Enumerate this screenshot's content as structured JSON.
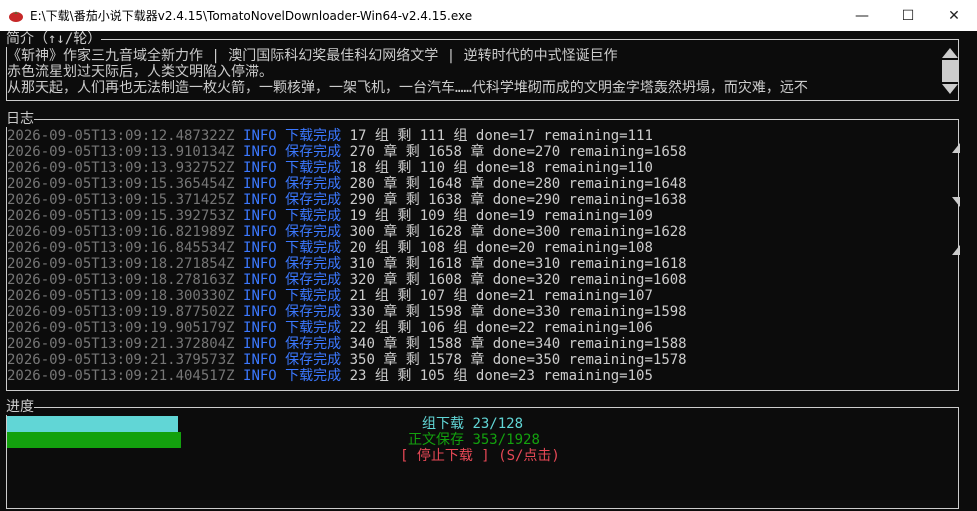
{
  "window": {
    "title": "E:\\下载\\番茄小说下载器v2.4.15\\TomatoNovelDownloader-Win64-v2.4.15.exe",
    "minimize_glyph": "—",
    "maximize_glyph": "☐",
    "close_glyph": "✕"
  },
  "intro": {
    "label": "简介（↑↓/轮）",
    "lines": [
      "《斩神》作家三九音域全新力作 | 澳门国际科幻奖最佳科幻网络文学 | 逆转时代的中式怪诞巨作",
      "赤色流星划过天际后，人类文明陷入停滞。",
      "从那天起，人们再也无法制造一枚火箭，一颗核弹，一架飞机，一台汽车……代科学堆砌而成的文明金字塔轰然坍塌，而灾难，远不"
    ]
  },
  "log": {
    "label": "日志",
    "rows": [
      {
        "ts": "2026-09-05T13:09:12.487322Z",
        "level": "INFO",
        "event": "下载完成",
        "msg": "17 组 剩 111 组 done=17 remaining=111"
      },
      {
        "ts": "2026-09-05T13:09:13.910134Z",
        "level": "INFO",
        "event": "保存完成",
        "msg": "270 章 剩 1658 章 done=270 remaining=1658"
      },
      {
        "ts": "2026-09-05T13:09:13.932752Z",
        "level": "INFO",
        "event": "下载完成",
        "msg": "18 组 剩 110 组 done=18 remaining=110"
      },
      {
        "ts": "2026-09-05T13:09:15.365454Z",
        "level": "INFO",
        "event": "保存完成",
        "msg": "280 章 剩 1648 章 done=280 remaining=1648"
      },
      {
        "ts": "2026-09-05T13:09:15.371425Z",
        "level": "INFO",
        "event": "保存完成",
        "msg": "290 章 剩 1638 章 done=290 remaining=1638"
      },
      {
        "ts": "2026-09-05T13:09:15.392753Z",
        "level": "INFO",
        "event": "下载完成",
        "msg": "19 组 剩 109 组 done=19 remaining=109"
      },
      {
        "ts": "2026-09-05T13:09:16.821989Z",
        "level": "INFO",
        "event": "保存完成",
        "msg": "300 章 剩 1628 章 done=300 remaining=1628"
      },
      {
        "ts": "2026-09-05T13:09:16.845534Z",
        "level": "INFO",
        "event": "下载完成",
        "msg": "20 组 剩 108 组 done=20 remaining=108"
      },
      {
        "ts": "2026-09-05T13:09:18.271854Z",
        "level": "INFO",
        "event": "保存完成",
        "msg": "310 章 剩 1618 章 done=310 remaining=1618"
      },
      {
        "ts": "2026-09-05T13:09:18.278163Z",
        "level": "INFO",
        "event": "保存完成",
        "msg": "320 章 剩 1608 章 done=320 remaining=1608"
      },
      {
        "ts": "2026-09-05T13:09:18.300330Z",
        "level": "INFO",
        "event": "下载完成",
        "msg": "21 组 剩 107 组 done=21 remaining=107"
      },
      {
        "ts": "2026-09-05T13:09:19.877502Z",
        "level": "INFO",
        "event": "保存完成",
        "msg": "330 章 剩 1598 章 done=330 remaining=1598"
      },
      {
        "ts": "2026-09-05T13:09:19.905179Z",
        "level": "INFO",
        "event": "下载完成",
        "msg": "22 组 剩 106 组 done=22 remaining=106"
      },
      {
        "ts": "2026-09-05T13:09:21.372804Z",
        "level": "INFO",
        "event": "保存完成",
        "msg": "340 章 剩 1588 章 done=340 remaining=1588"
      },
      {
        "ts": "2026-09-05T13:09:21.379573Z",
        "level": "INFO",
        "event": "保存完成",
        "msg": "350 章 剩 1578 章 done=350 remaining=1578"
      },
      {
        "ts": "2026-09-05T13:09:21.404517Z",
        "level": "INFO",
        "event": "下载完成",
        "msg": "23 组 剩 105 组 done=23 remaining=105"
      }
    ]
  },
  "progress": {
    "label": "进度",
    "group_download": {
      "label": "组下载",
      "value": "23/128",
      "done": 23,
      "total": 128,
      "color": "#61d6d6"
    },
    "chapter_save": {
      "label": "正文保存",
      "value": "353/1928",
      "done": 353,
      "total": 1928,
      "color": "#13a10e"
    },
    "stop_button": {
      "label": "[ 停止下载 ] (S/点击)",
      "color": "#e74856"
    }
  },
  "colors": {
    "background": "#0c0c0c",
    "foreground": "#cccccc",
    "timestamp": "#767676",
    "accent_blue": "#3b78ff"
  }
}
